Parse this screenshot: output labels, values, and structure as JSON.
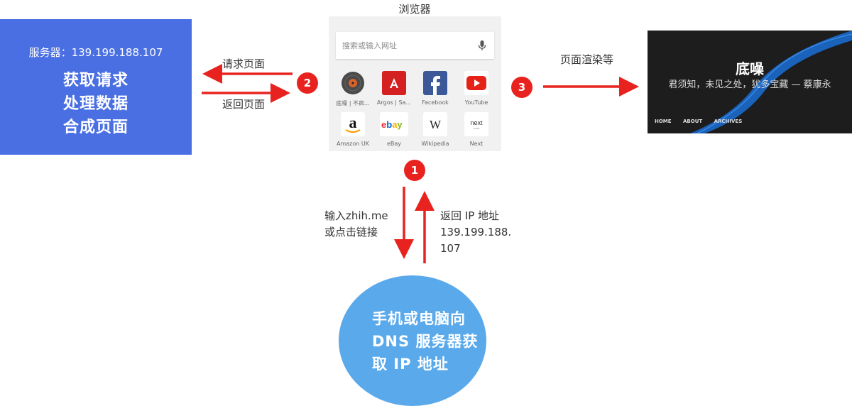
{
  "server": {
    "address": "服务器：139.199.188.107",
    "lines": [
      "获取请求",
      "处理数据",
      "合成页面"
    ]
  },
  "browser": {
    "title": "浏览器",
    "search_placeholder": "搜索或输入网址",
    "tiles": [
      {
        "label": "底噪 | 不疯..."
      },
      {
        "label": "Argos | Sa..."
      },
      {
        "label": "Facebook"
      },
      {
        "label": "YouTube"
      },
      {
        "label": "Amazon UK"
      },
      {
        "label": "eBay"
      },
      {
        "label": "Wikipedia"
      },
      {
        "label": "Next"
      }
    ]
  },
  "arrows": {
    "request_page": "请求页面",
    "return_page": "返回页面",
    "render_etc": "页面渲染等",
    "input_line1": "输入zhih.me",
    "input_line2": "或点击链接",
    "return_ip_line1": "返回 IP 地址",
    "return_ip_line2": "139.199.188.",
    "return_ip_line3": "107"
  },
  "badges": {
    "one": "1",
    "two": "2",
    "three": "3"
  },
  "blog": {
    "title": "底噪",
    "subtitle": "君须知，未见之处，犹多宝藏 — 蔡康永",
    "nav": [
      "HOME",
      "ABOUT",
      "ARCHIVES"
    ]
  },
  "dns": {
    "lines": [
      "手机或电脑向",
      "DNS 服务器获",
      "取 IP 地址"
    ]
  },
  "colors": {
    "server_bg": "#4a6fe3",
    "arrow_red": "#e8231f",
    "dns_bg": "#5aa9eb",
    "blog_bg": "#1d1d1d",
    "blog_stripe": "#1a6fd6"
  }
}
